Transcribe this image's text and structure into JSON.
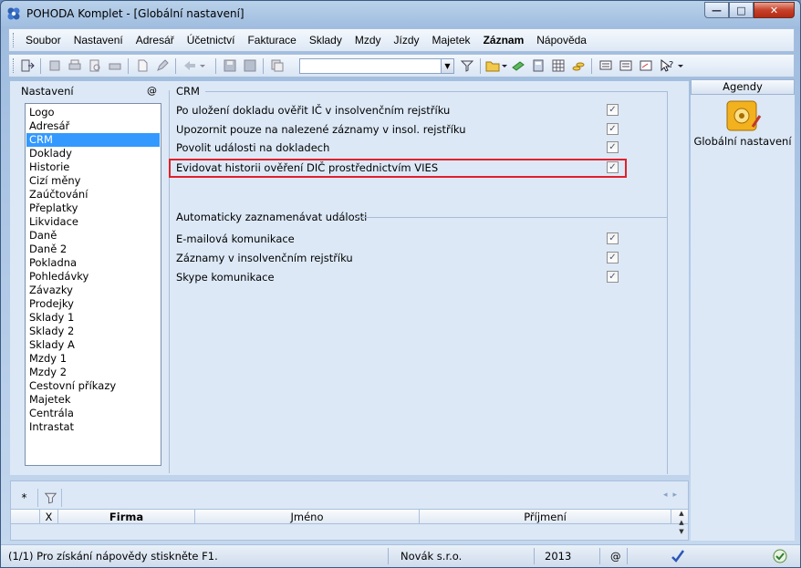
{
  "window": {
    "title": "POHODA Komplet - [Globální nastavení]"
  },
  "caption_buttons": {
    "minimize": "—",
    "maximize": "□",
    "close": "✕"
  },
  "menu": [
    {
      "label": "Soubor",
      "bold": false
    },
    {
      "label": "Nastavení",
      "bold": false
    },
    {
      "label": "Adresář",
      "bold": false
    },
    {
      "label": "Účetnictví",
      "bold": false
    },
    {
      "label": "Fakturace",
      "bold": false
    },
    {
      "label": "Sklady",
      "bold": false
    },
    {
      "label": "Mzdy",
      "bold": false
    },
    {
      "label": "Jízdy",
      "bold": false
    },
    {
      "label": "Majetek",
      "bold": false
    },
    {
      "label": "Záznam",
      "bold": true
    },
    {
      "label": "Nápověda",
      "bold": false
    }
  ],
  "toolbar": {
    "combo_value": ""
  },
  "left": {
    "heading": "Nastavení",
    "at_symbol": "@",
    "items": [
      "Logo",
      "Adresář",
      "CRM",
      "Doklady",
      "Historie",
      "Cizí měny",
      "Zaúčtování",
      "Přeplatky",
      "Likvidace",
      "Daně",
      "Daně 2",
      "Pokladna",
      "Pohledávky",
      "Závazky",
      "Prodejky",
      "Sklady 1",
      "Sklady 2",
      "Sklady A",
      "Mzdy 1",
      "Mzdy 2",
      "Cestovní příkazy",
      "Majetek",
      "Centrála",
      "Intrastat"
    ],
    "selected": "CRM"
  },
  "crm": {
    "title": "CRM",
    "options": [
      {
        "label": "Po uložení dokladu ověřit IČ v insolvenčním rejstříku",
        "checked": true
      },
      {
        "label": "Upozornit pouze na nalezené záznamy v insol. rejstříku",
        "checked": true
      },
      {
        "label": "Povolit události na dokladech",
        "checked": true
      },
      {
        "label": "Evidovat historii ověření DIČ prostřednictvím VIES",
        "checked": true,
        "highlighted": true
      }
    ]
  },
  "events": {
    "title": "Automaticky zaznamenávat události",
    "options": [
      {
        "label": "E-mailová komunikace",
        "checked": true
      },
      {
        "label": "Záznamy v insolvenčním rejstříku",
        "checked": true
      },
      {
        "label": "Skype komunikace",
        "checked": true
      }
    ]
  },
  "agenda": {
    "heading": "Agendy",
    "item_label": "Globální nastavení"
  },
  "grid": {
    "tab_star": "*",
    "columns": [
      "X",
      "Firma",
      "Jméno",
      "Příjmení"
    ]
  },
  "status": {
    "help": "(1/1) Pro získání nápovědy stiskněte F1.",
    "company": "Novák  s.r.o.",
    "year": "2013",
    "at": "@"
  },
  "colors": {
    "selection": "#3399ff",
    "highlight_border": "#e0202a",
    "panel_bg": "#dce8f6"
  }
}
